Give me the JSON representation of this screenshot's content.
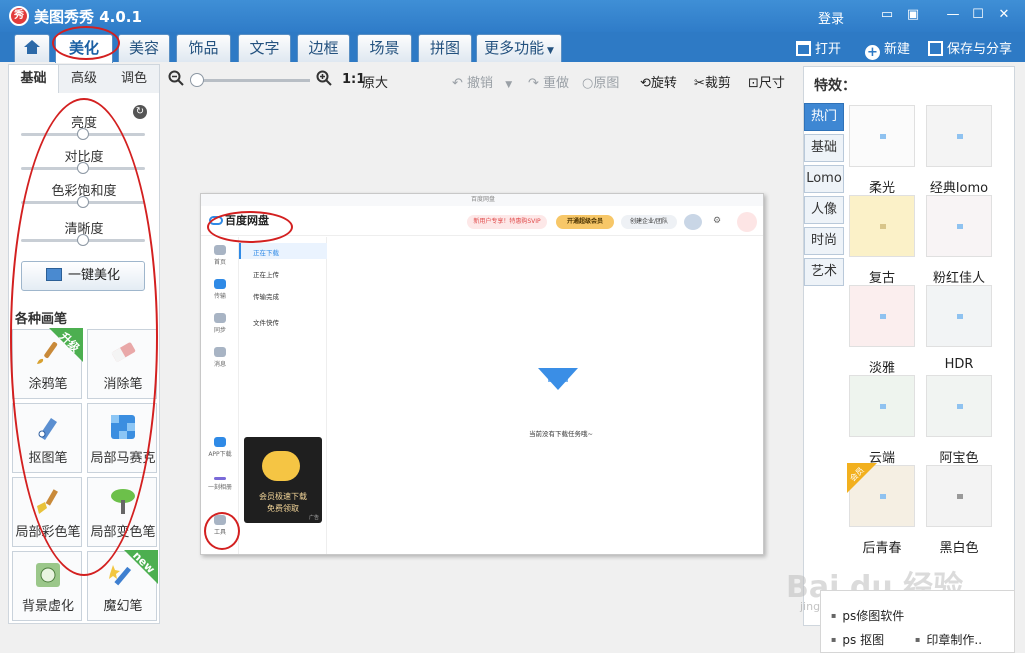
{
  "window": {
    "title": "美图秀秀 4.0.1",
    "logo_text": "秀",
    "login": "登录"
  },
  "tabs": [
    {
      "label": "美化",
      "active": true
    },
    {
      "label": "美容"
    },
    {
      "label": "饰品"
    },
    {
      "label": "文字"
    },
    {
      "label": "边框"
    },
    {
      "label": "场景"
    },
    {
      "label": "拼图"
    },
    {
      "label": "更多功能"
    }
  ],
  "file_actions": {
    "open": "打开",
    "new": "新建",
    "save_share": "保存与分享"
  },
  "left_panel": {
    "subtabs": [
      "基础",
      "高级",
      "调色"
    ],
    "sliders": [
      "亮度",
      "对比度",
      "色彩饱和度",
      "清晰度"
    ],
    "onekey_label": "一键美化",
    "brushes_title": "各种画笔",
    "brushes": [
      {
        "label": "涂鸦笔",
        "badge": "升级"
      },
      {
        "label": "消除笔"
      },
      {
        "label": "抠图笔"
      },
      {
        "label": "局部马赛克"
      },
      {
        "label": "局部彩色笔"
      },
      {
        "label": "局部变色笔"
      },
      {
        "label": "背景虚化"
      },
      {
        "label": "魔幻笔",
        "badge": "new"
      }
    ]
  },
  "toolbar": {
    "ratio": "1:1",
    "original_size": "原大",
    "undo": "撤销",
    "redo": "重做",
    "original": "原图",
    "rotate": "旋转",
    "crop": "裁剪",
    "size": "尺寸"
  },
  "photo": {
    "window_title": "百度网盘",
    "logo": "百度网盘",
    "promo": "新用户专享！特惠购SVIP",
    "vip_button": "开通超级会员",
    "enterprise": "创建企业/团队",
    "sidebar": [
      "首页",
      "传输",
      "同步",
      "消息",
      "APP下载",
      "一刻相册",
      "工具"
    ],
    "list": [
      "正在下载",
      "正在上传",
      "传输完成",
      "文件快传"
    ],
    "empty_text": "当前没有下载任务哦~",
    "ad_line1": "会员极速下载",
    "ad_line2": "免费领取",
    "ad_tag": "广告"
  },
  "right_panel": {
    "title": "特效：",
    "categories": [
      "热门",
      "基础",
      "Lomo",
      "人像",
      "时尚",
      "艺术"
    ],
    "effects": [
      "柔光",
      "经典lomo",
      "复古",
      "粉红佳人",
      "淡雅",
      "HDR",
      "云端",
      "阿宝色",
      "后青春",
      "黑白色"
    ],
    "effect_badge": "会员"
  },
  "watermark": {
    "text": "Bai du 经验",
    "sub": "jingyan.baidu.com"
  },
  "popup": [
    "ps修图软件",
    "ps 抠图",
    "印章制作.."
  ],
  "colors": {
    "title_bar": "#2f7cc8",
    "annotation": "#d32020",
    "category_active": "#3e87d3"
  }
}
